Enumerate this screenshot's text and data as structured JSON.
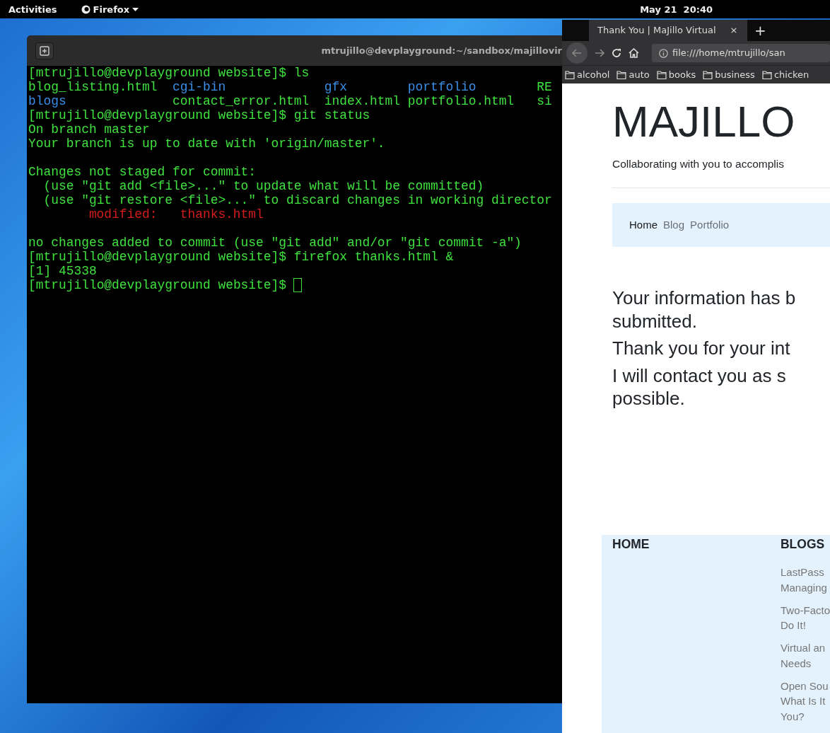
{
  "top_bar": {
    "activities": "Activities",
    "app_menu": "Firefox",
    "clock": "May 21  20:40"
  },
  "terminal": {
    "title": "mtrujillo@devplayground:~/sandbox/majillovir",
    "lines": [
      {
        "kind": "prompt",
        "text": "[mtrujillo@devplayground website]$ ls"
      },
      {
        "kind": "listing",
        "entries": [
          {
            "name": "blog_listing.html",
            "kind": "file"
          },
          {
            "name": "cgi-bin",
            "kind": "dir"
          },
          {
            "name": "gfx",
            "kind": "dir"
          },
          {
            "name": "portfolio",
            "kind": "dir"
          },
          {
            "name": "RE",
            "kind": "file"
          }
        ]
      },
      {
        "kind": "listing",
        "entries": [
          {
            "name": "blogs",
            "kind": "dir"
          },
          {
            "name": "contact_error.html",
            "kind": "file"
          },
          {
            "name": "index.html",
            "kind": "file"
          },
          {
            "name": "portfolio.html",
            "kind": "file"
          },
          {
            "name": "si",
            "kind": "file"
          }
        ]
      },
      {
        "kind": "prompt",
        "text": "[mtrujillo@devplayground website]$ git status"
      },
      {
        "kind": "output",
        "text": "On branch master"
      },
      {
        "kind": "output",
        "text": "Your branch is up to date with 'origin/master'."
      },
      {
        "kind": "blank"
      },
      {
        "kind": "output",
        "text": "Changes not staged for commit:"
      },
      {
        "kind": "output",
        "text": "  (use \"git add <file>...\" to update what will be committed)"
      },
      {
        "kind": "output",
        "text": "  (use \"git restore <file>...\" to discard changes in working director"
      },
      {
        "kind": "modified",
        "label": "modified:",
        "file": "thanks.html"
      },
      {
        "kind": "blank"
      },
      {
        "kind": "output",
        "text": "no changes added to commit (use \"git add\" and/or \"git commit -a\")"
      },
      {
        "kind": "prompt",
        "text": "[mtrujillo@devplayground website]$ firefox thanks.html &"
      },
      {
        "kind": "output",
        "text": "[1] 45338"
      },
      {
        "kind": "prompt",
        "text": "[mtrujillo@devplayground website]$",
        "cursor": true
      }
    ]
  },
  "browser": {
    "tab_title": "Thank You | MaJillo Virtual",
    "tab_close": "×",
    "new_tab": "+",
    "url": "file:///home/mtrujillo/san",
    "bookmarks": [
      "alcohol",
      "auto",
      "books",
      "business",
      "chicken"
    ],
    "page": {
      "brand": "MAJILLO",
      "tagline": "Collaborating with you to accomplis",
      "nav": [
        {
          "label": "Home",
          "selected": true
        },
        {
          "label": "Blog",
          "selected": false
        },
        {
          "label": "Portfolio",
          "selected": false
        }
      ],
      "message": [
        "Your information has b\nsubmitted.",
        "Thank you for your int",
        "I will contact you as s\npossible."
      ],
      "footer": {
        "home_heading": "HOME",
        "blogs_heading": "BLOGS",
        "blog_links": [
          "LastPass\nManaging",
          "Two-Facto\nDo It!",
          "Virtual an\nNeeds",
          "Open Sou\nWhat Is It\nYou?"
        ]
      }
    }
  }
}
